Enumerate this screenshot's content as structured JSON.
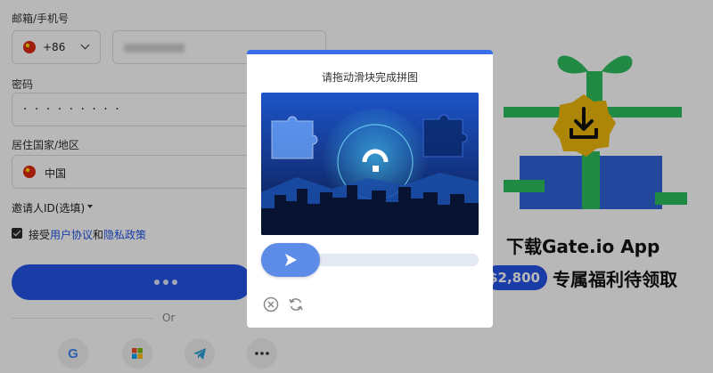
{
  "form": {
    "phone_label": "邮箱/手机号",
    "country_code": "+86",
    "password_label": "密码",
    "password_mask": "· · · · · · · · ·",
    "residence_label": "居住国家/地区",
    "residence_value": "中国",
    "referral_label": "邀请人ID(选填)",
    "agree_prefix": "接受",
    "user_agreement": "用户协议",
    "agree_and": "和",
    "privacy_policy": "隐私政策",
    "or_text": "Or"
  },
  "promo": {
    "title": "下载Gate.io App",
    "amount": "$2,800",
    "subtitle": "专属福利待领取"
  },
  "captcha": {
    "title": "请拖动滑块完成拼图",
    "slider_position": 0.08
  },
  "social_icons": [
    "google-icon",
    "microsoft-icon",
    "telegram-icon",
    "more-icon"
  ],
  "colors": {
    "accent": "#2354e6",
    "slider": "#5c8be8",
    "gift_green": "#2dbf5f",
    "gift_blue": "#2f65d8",
    "badge_gold": "#f0b90b"
  }
}
